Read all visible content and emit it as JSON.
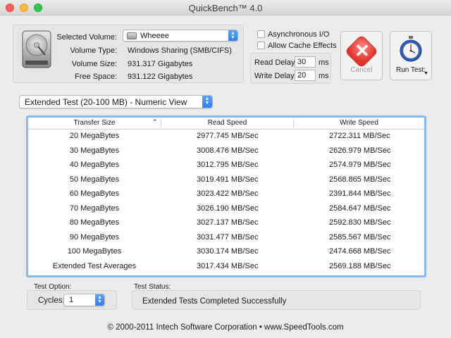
{
  "window": {
    "title": "QuickBench™ 4.0"
  },
  "volume_info": {
    "selected_volume_label": "Selected Volume:",
    "selected_volume_value": "Wheeee",
    "volume_type_label": "Volume Type:",
    "volume_type_value": "Windows Sharing (SMB/CIFS)",
    "volume_size_label": "Volume Size:",
    "volume_size_value": "931.317 Gigabytes",
    "free_space_label": "Free Space:",
    "free_space_value": "931.122 Gigabytes"
  },
  "options": {
    "async_io_label": "Asynchronous I/O",
    "async_io_checked": false,
    "allow_cache_label": "Allow Cache Effects",
    "allow_cache_checked": false,
    "read_delay_label": "Read Delay:",
    "read_delay_value": "30",
    "read_delay_unit": "ms",
    "write_delay_label": "Write Delay:",
    "write_delay_value": "20",
    "write_delay_unit": "ms"
  },
  "buttons": {
    "cancel_label": "Cancel",
    "run_test_label": "Run Test:"
  },
  "view_selector": {
    "selected": "Extended Test (20-100 MB) - Numeric View"
  },
  "results_table": {
    "columns": [
      "Transfer Size",
      "Read Speed",
      "Write Speed"
    ],
    "rows": [
      [
        "20 MegaBytes",
        "2977.745 MB/Sec",
        "2722.311 MB/Sec"
      ],
      [
        "30 MegaBytes",
        "3008.476 MB/Sec",
        "2626.979 MB/Sec"
      ],
      [
        "40 MegaBytes",
        "3012.795 MB/Sec",
        "2574.979 MB/Sec"
      ],
      [
        "50 MegaBytes",
        "3019.491 MB/Sec",
        "2568.865 MB/Sec"
      ],
      [
        "60 MegaBytes",
        "3023.422 MB/Sec",
        "2391.844 MB/Sec"
      ],
      [
        "70 MegaBytes",
        "3026.190 MB/Sec",
        "2584.647 MB/Sec"
      ],
      [
        "80 MegaBytes",
        "3027.137 MB/Sec",
        "2592.830 MB/Sec"
      ],
      [
        "90 MegaBytes",
        "3031.477 MB/Sec",
        "2585.567 MB/Sec"
      ],
      [
        "100 MegaBytes",
        "3030.174 MB/Sec",
        "2474.668 MB/Sec"
      ],
      [
        "Extended Test Averages",
        "3017.434 MB/Sec",
        "2569.188 MB/Sec"
      ]
    ]
  },
  "test_option": {
    "title": "Test Option:",
    "cycles_label": "Cycles:",
    "cycles_value": "1"
  },
  "test_status": {
    "title": "Test Status:",
    "message": "Extended Tests Completed Successfully"
  },
  "footer": {
    "text": "© 2000-2011 Intech Software Corporation • www.SpeedTools.com"
  },
  "colors": {
    "table_focus_ring": "#87b8ef",
    "popup_arrow_blue": "#2f7ff0",
    "cancel_red": "#e23228"
  }
}
